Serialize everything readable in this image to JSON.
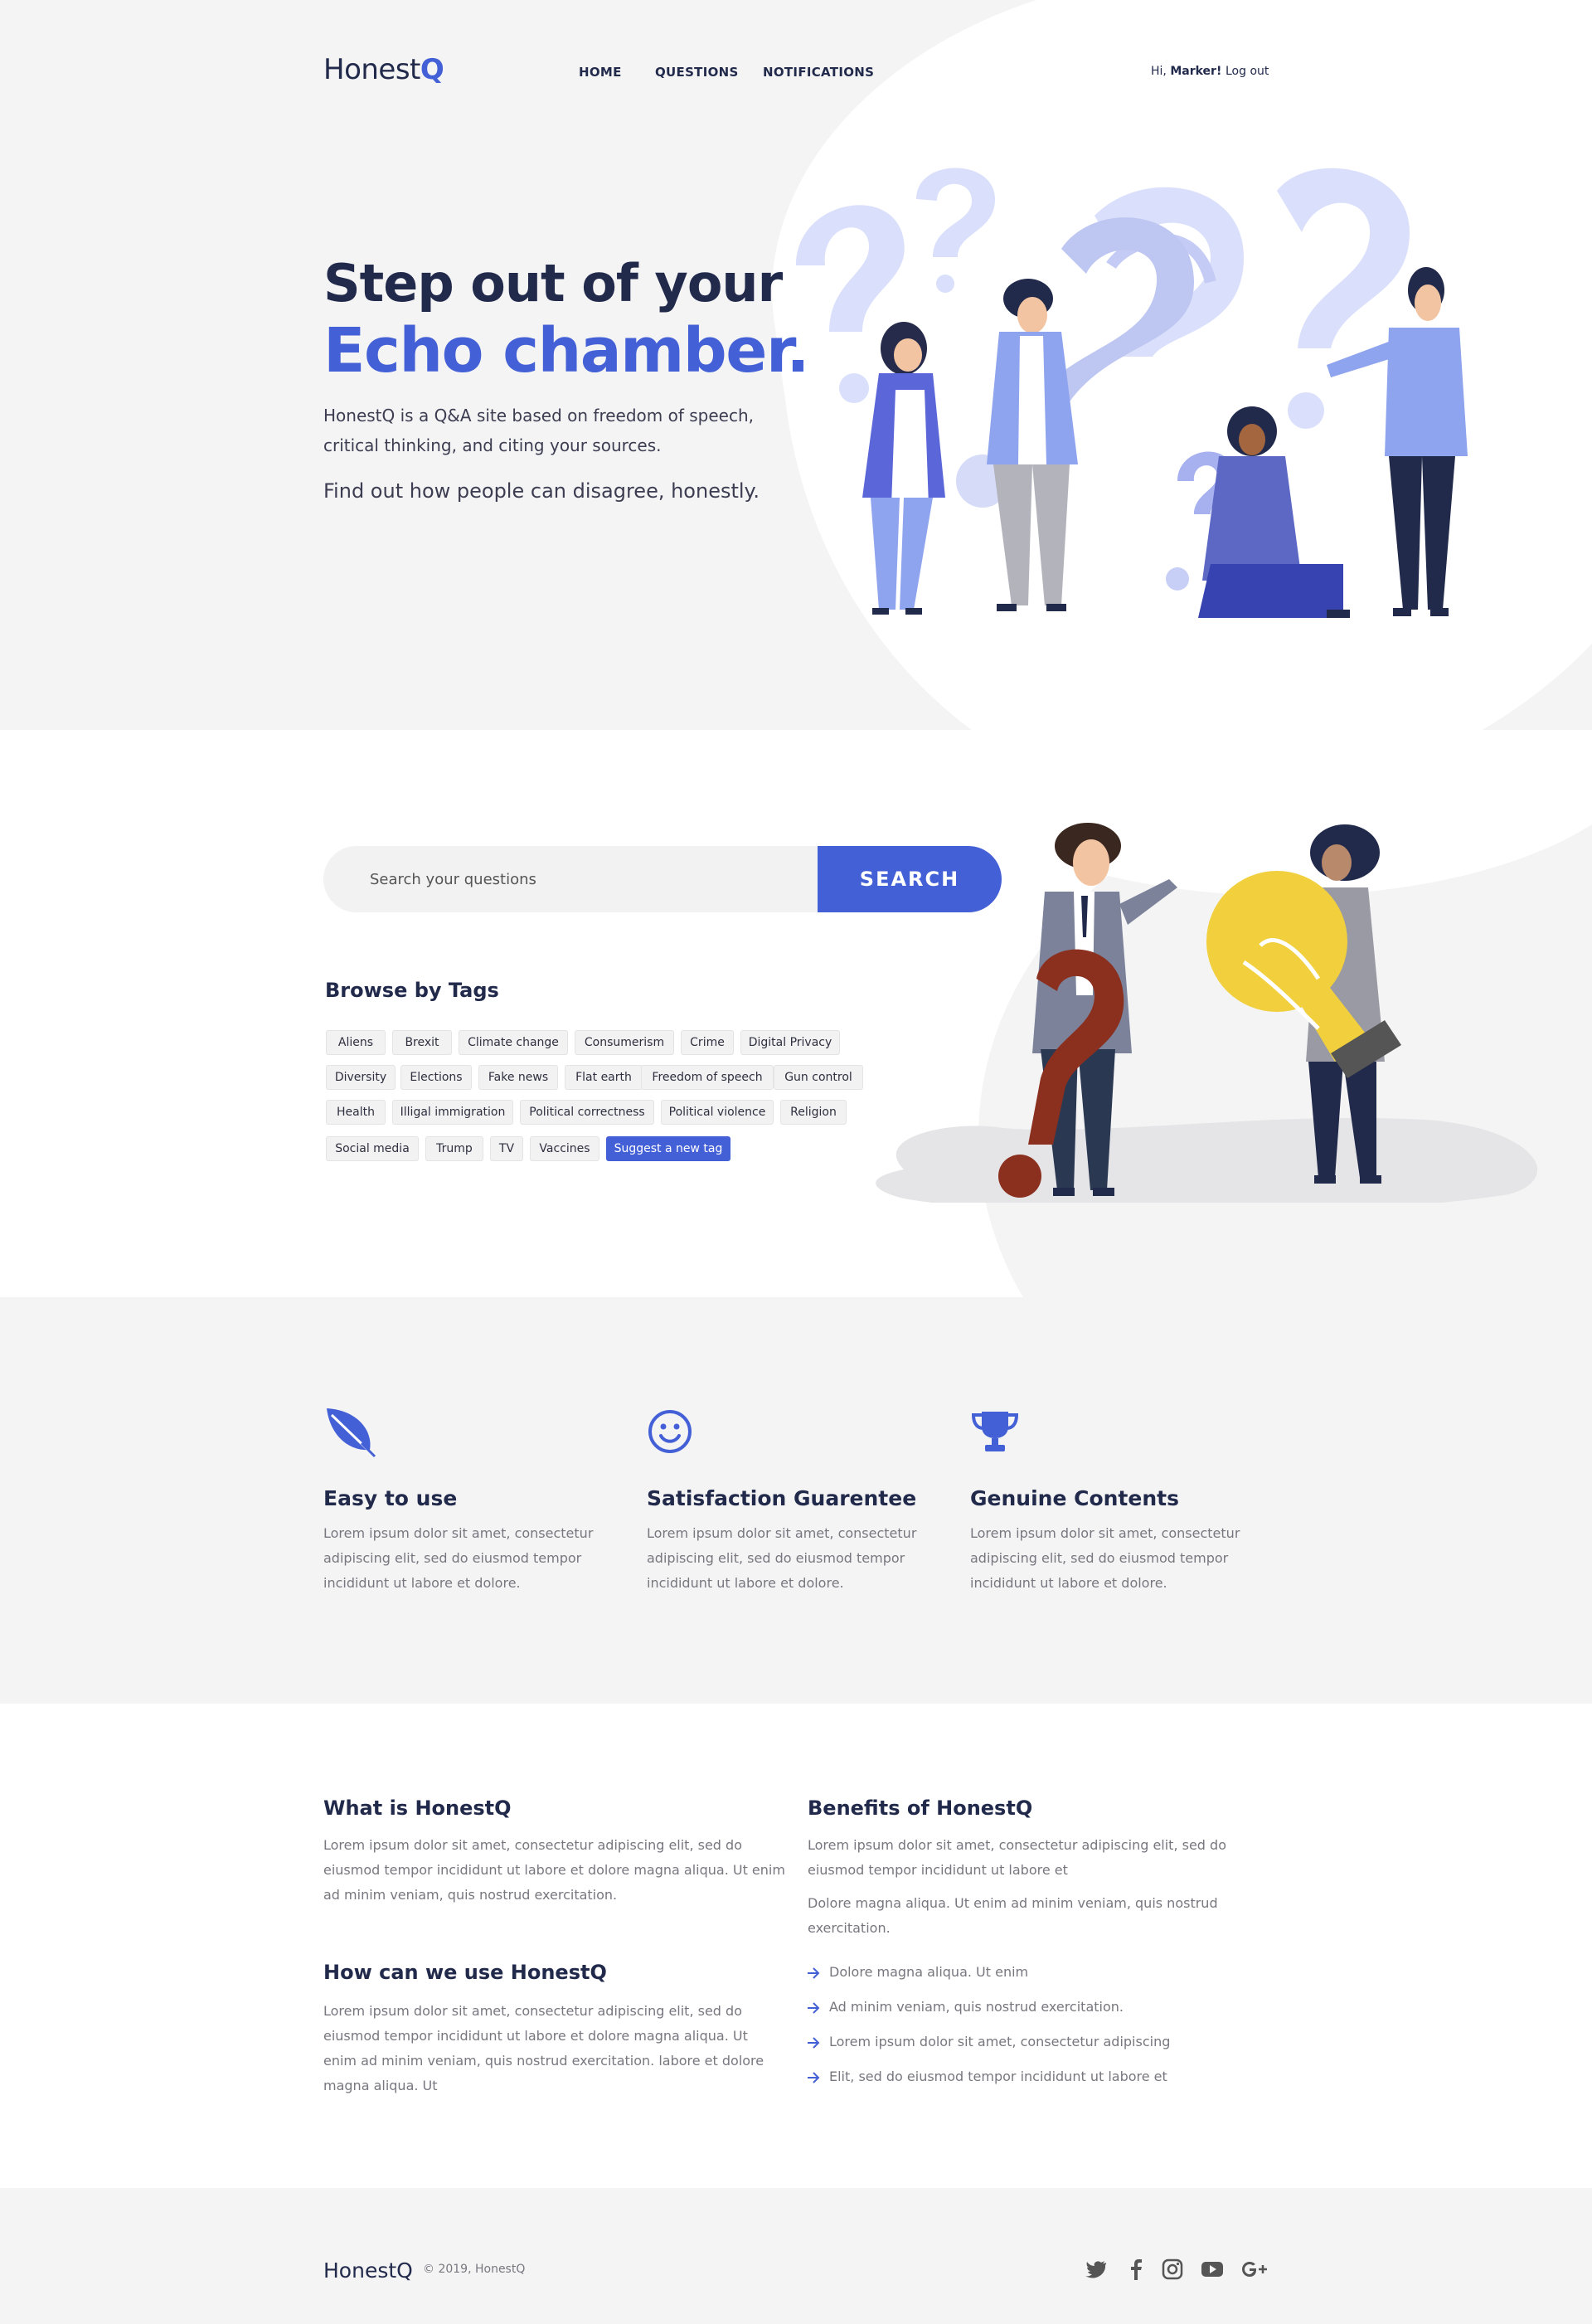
{
  "header": {
    "logo_main": "Honest",
    "logo_accent": "Q",
    "nav": [
      "HOME",
      "QUESTIONS",
      "NOTIFICATIONS"
    ],
    "greeting": "Hi,",
    "username": "Marker!",
    "logout": "Log out"
  },
  "hero": {
    "title_line1": "Step out of your",
    "title_line2": "Echo chamber.",
    "description": "HonestQ is a Q&A site based on freedom of speech, critical thinking, and citing your sources.",
    "tagline": "Find out how people can disagree, honestly."
  },
  "search": {
    "placeholder": "Search your questions",
    "button": "SEARCH"
  },
  "tags": {
    "heading": "Browse by Tags",
    "items": [
      "Aliens",
      "Brexit",
      "Climate change",
      "Consumerism",
      "Crime",
      "Digital Privacy",
      "Diversity",
      "Elections",
      "Fake news",
      "Flat earth",
      "Freedom of speech",
      "Gun control",
      "Health",
      "Illigal immigration",
      "Political correctness",
      "Political violence",
      "Religion",
      "Social media",
      "Trump",
      "TV",
      "Vaccines"
    ],
    "suggest": "Suggest a new tag"
  },
  "features": [
    {
      "icon": "leaf-icon",
      "title": "Easy to use",
      "text": "Lorem ipsum dolor sit amet, consectetur adipiscing elit, sed do eiusmod tempor incididunt ut labore et dolore."
    },
    {
      "icon": "smiley-icon",
      "title": "Satisfaction Guarentee",
      "text": "Lorem ipsum dolor sit amet, consectetur adipiscing elit, sed do eiusmod tempor incididunt ut labore et dolore."
    },
    {
      "icon": "trophy-icon",
      "title": "Genuine Contents",
      "text": "Lorem ipsum dolor sit amet, consectetur adipiscing elit, sed do eiusmod tempor incididunt ut labore et dolore."
    }
  ],
  "info": {
    "what_title": "What is HonestQ",
    "what_text": "Lorem ipsum dolor sit amet, consectetur adipiscing elit, sed do eiusmod tempor incididunt ut labore et dolore magna aliqua. Ut enim ad minim veniam, quis nostrud exercitation.",
    "how_title": "How can we use HonestQ",
    "how_text": "Lorem ipsum dolor sit amet, consectetur adipiscing elit, sed do eiusmod tempor incididunt ut labore et dolore magna aliqua. Ut enim ad minim veniam, quis nostrud exercitation. labore et dolore magna aliqua. Ut",
    "benefits_title": "Benefits of HonestQ",
    "benefits_text1": "Lorem ipsum dolor sit amet, consectetur adipiscing elit, sed do eiusmod tempor incididunt ut labore et",
    "benefits_text2": "Dolore magna aliqua. Ut enim ad minim veniam, quis nostrud exercitation.",
    "benefits_list": [
      "Dolore magna aliqua. Ut enim",
      "Ad minim veniam, quis nostrud exercitation.",
      "Lorem ipsum dolor sit amet, consectetur adipiscing",
      "Elit, sed do eiusmod tempor incididunt ut labore et"
    ]
  },
  "footer": {
    "logo": "HonestQ",
    "copyright": "© 2019, HonestQ",
    "social": [
      "twitter-icon",
      "facebook-icon",
      "instagram-icon",
      "youtube-icon",
      "google-plus-icon"
    ]
  },
  "colors": {
    "accent": "#4460d6",
    "dark": "#222a4c",
    "muted": "#77777f",
    "panel": "#f4f4f5"
  }
}
